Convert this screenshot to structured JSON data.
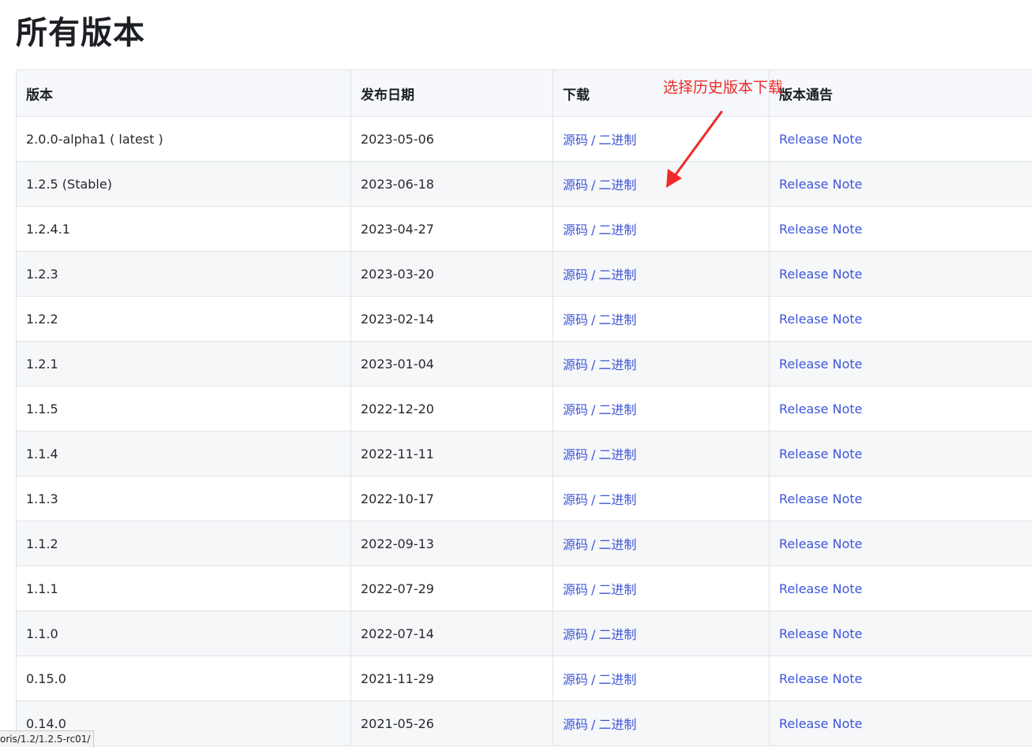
{
  "page": {
    "title": "所有版本"
  },
  "table": {
    "headers": {
      "version": "版本",
      "date": "发布日期",
      "download": "下载",
      "notice": "版本通告"
    },
    "rows": [
      {
        "version": "2.0.0-alpha1 ( latest )",
        "date": "2023-05-06",
        "source": "源码",
        "binary": "二进制",
        "note": "Release Note"
      },
      {
        "version": "1.2.5 (Stable)",
        "date": "2023-06-18",
        "source": "源码",
        "binary": "二进制",
        "note": "Release Note"
      },
      {
        "version": "1.2.4.1",
        "date": "2023-04-27",
        "source": "源码",
        "binary": "二进制",
        "note": "Release Note"
      },
      {
        "version": "1.2.3",
        "date": "2023-03-20",
        "source": "源码",
        "binary": "二进制",
        "note": "Release Note"
      },
      {
        "version": "1.2.2",
        "date": "2023-02-14",
        "source": "源码",
        "binary": "二进制",
        "note": "Release Note"
      },
      {
        "version": "1.2.1",
        "date": "2023-01-04",
        "source": "源码",
        "binary": "二进制",
        "note": "Release Note"
      },
      {
        "version": "1.1.5",
        "date": "2022-12-20",
        "source": "源码",
        "binary": "二进制",
        "note": "Release Note"
      },
      {
        "version": "1.1.4",
        "date": "2022-11-11",
        "source": "源码",
        "binary": "二进制",
        "note": "Release Note"
      },
      {
        "version": "1.1.3",
        "date": "2022-10-17",
        "source": "源码",
        "binary": "二进制",
        "note": "Release Note"
      },
      {
        "version": "1.1.2",
        "date": "2022-09-13",
        "source": "源码",
        "binary": "二进制",
        "note": "Release Note"
      },
      {
        "version": "1.1.1",
        "date": "2022-07-29",
        "source": "源码",
        "binary": "二进制",
        "note": "Release Note"
      },
      {
        "version": "1.1.0",
        "date": "2022-07-14",
        "source": "源码",
        "binary": "二进制",
        "note": "Release Note"
      },
      {
        "version": "0.15.0",
        "date": "2021-11-29",
        "source": "源码",
        "binary": "二进制",
        "note": "Release Note"
      },
      {
        "version": "0.14.0",
        "date": "2021-05-26",
        "source": "源码",
        "binary": "二进制",
        "note": "Release Note"
      }
    ],
    "link_separator": "/"
  },
  "annotation": {
    "text": "选择历史版本下载",
    "color": "#f02a2a"
  },
  "status_bar": {
    "url_text": "oris/1.2/1.2.5-rc01/"
  },
  "colors": {
    "link": "#3d56d9",
    "header_bg": "#f6f8fb",
    "stripe_bg": "#f6f7f9",
    "border": "#dfe2e5"
  }
}
